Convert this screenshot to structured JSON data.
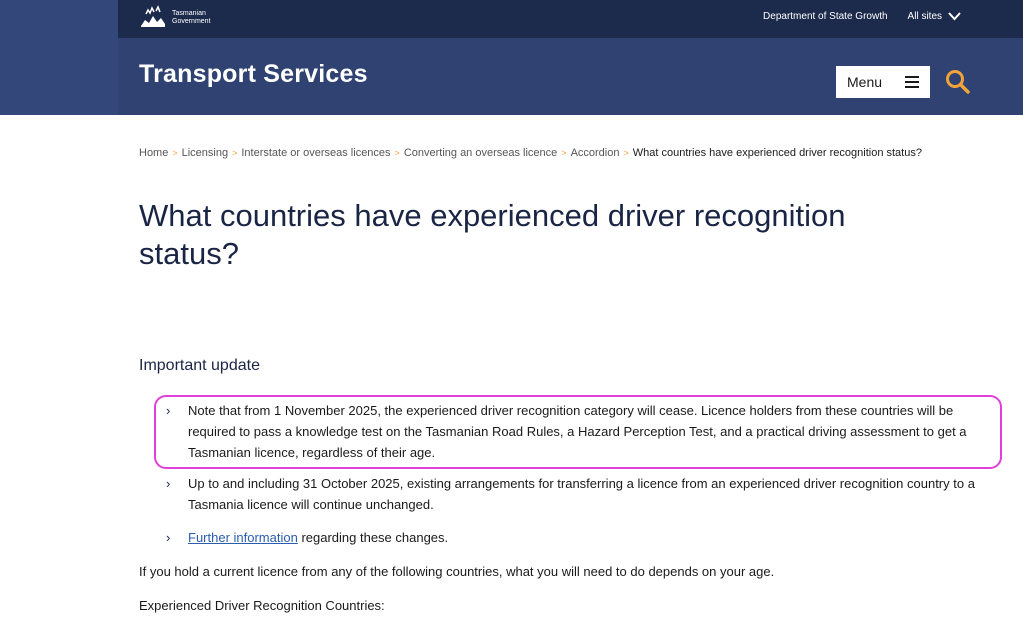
{
  "header": {
    "logo_text_line1": "Tasmanian",
    "logo_text_line2": "Government",
    "dept_link": "Department of State Growth",
    "all_sites": "All sites",
    "site_title": "Transport Services",
    "menu_label": "Menu"
  },
  "breadcrumb": {
    "items": [
      "Home",
      "Licensing",
      "Interstate or overseas licences",
      "Converting an overseas licence",
      "Accordion"
    ],
    "current": "What countries have experienced driver recognition status?",
    "separator": ">"
  },
  "main": {
    "title": "What countries have experienced driver recognition status?",
    "subhead": "Important update",
    "bullets": [
      {
        "text": "Note that from 1 November 2025, the experienced driver recognition category will cease. Licence holders from these countries will be required to pass a knowledge test on the Tasmanian Road Rules, a Hazard Perception Test, and a practical driving assessment to get a Tasmanian licence, regardless of their age."
      },
      {
        "text": "Up to and including 31 October 2025, existing arrangements for transferring a licence from an experienced driver recognition country to a Tasmania licence will continue unchanged."
      },
      {
        "link": "Further information",
        "text": " regarding these changes."
      }
    ],
    "bullet_marker": "›",
    "para1": "If you hold a current licence from any of the following countries, what you will need to do depends on your age.",
    "para2": "Experienced Driver Recognition Countries:"
  },
  "colors": {
    "top_bar": "#1c2a4c",
    "brand_bar": "#2f4272",
    "accent": "#f2a33a",
    "highlight": "#e040d9",
    "link": "#2a5db0"
  }
}
